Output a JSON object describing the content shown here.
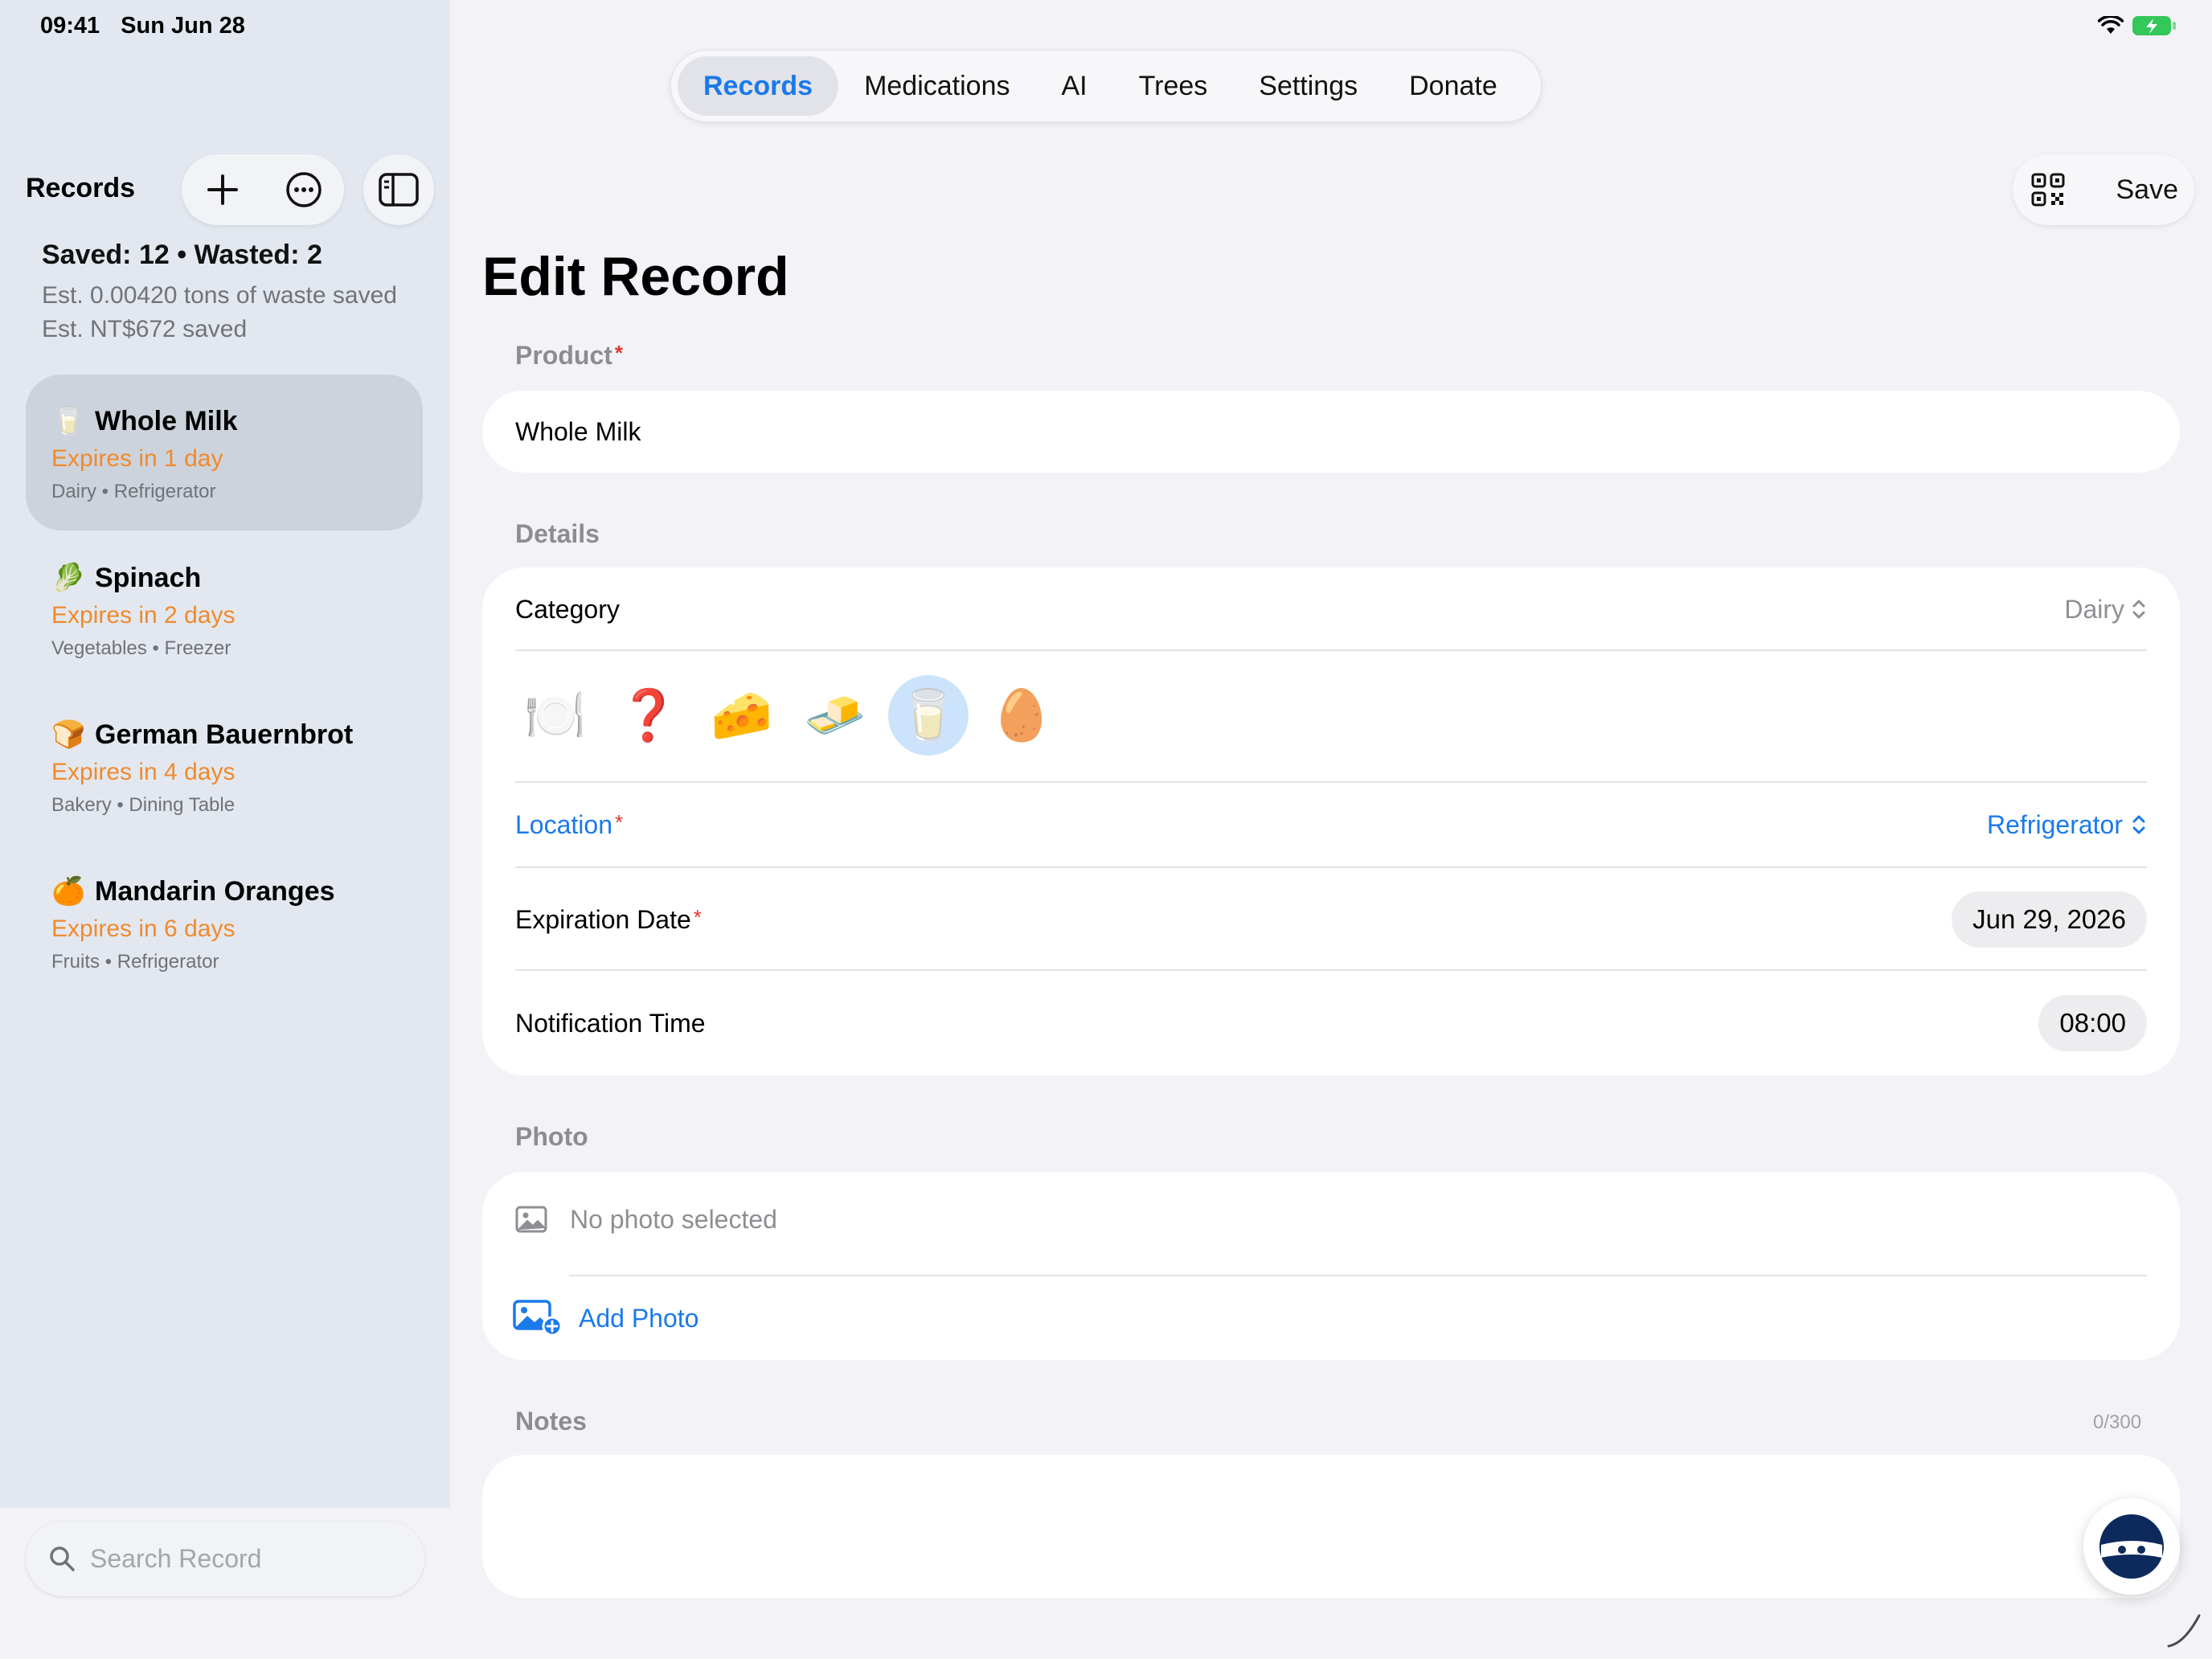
{
  "status": {
    "time": "09:41",
    "date": "Sun Jun 28"
  },
  "tabs": [
    "Records",
    "Medications",
    "AI",
    "Trees",
    "Settings",
    "Donate"
  ],
  "sidebar": {
    "title": "Records",
    "stats": {
      "summary": "Saved: 12 • Wasted: 2",
      "waste": "Est. 0.00420 tons of waste saved",
      "money": "Est. NT$672 saved"
    },
    "records": [
      {
        "emoji": "🥛",
        "name": "Whole Milk",
        "expires": "Expires in 1 day",
        "meta": "Dairy • Refrigerator"
      },
      {
        "emoji": "🥬",
        "name": "Spinach",
        "expires": "Expires in 2 days",
        "meta": "Vegetables • Freezer"
      },
      {
        "emoji": "🍞",
        "name": "German Bauernbrot",
        "expires": "Expires in 4 days",
        "meta": "Bakery • Dining Table"
      },
      {
        "emoji": "🍊",
        "name": "Mandarin Oranges",
        "expires": "Expires in 6 days",
        "meta": "Fruits • Refrigerator"
      }
    ],
    "search_placeholder": "Search Record"
  },
  "toolbar": {
    "save_label": "Save"
  },
  "form": {
    "title": "Edit Record",
    "product_label": "Product",
    "product_value": "Whole Milk",
    "details_label": "Details",
    "category_label": "Category",
    "category_value": "Dairy",
    "category_icons": [
      "🍽️",
      "❓",
      "🧀",
      "🧈",
      "🥛",
      "🥚"
    ],
    "location_label": "Location",
    "location_value": "Refrigerator",
    "expiration_label": "Expiration Date",
    "expiration_value": "Jun 29, 2026",
    "notification_label": "Notification Time",
    "notification_value": "08:00",
    "photo_label": "Photo",
    "no_photo": "No photo selected",
    "add_photo": "Add Photo",
    "notes_label": "Notes",
    "notes_count": "0/300",
    "required_mark": "*"
  },
  "colors": {
    "accent": "#1A7AEB",
    "warning": "#F08A2C",
    "required": "#E5352B"
  }
}
